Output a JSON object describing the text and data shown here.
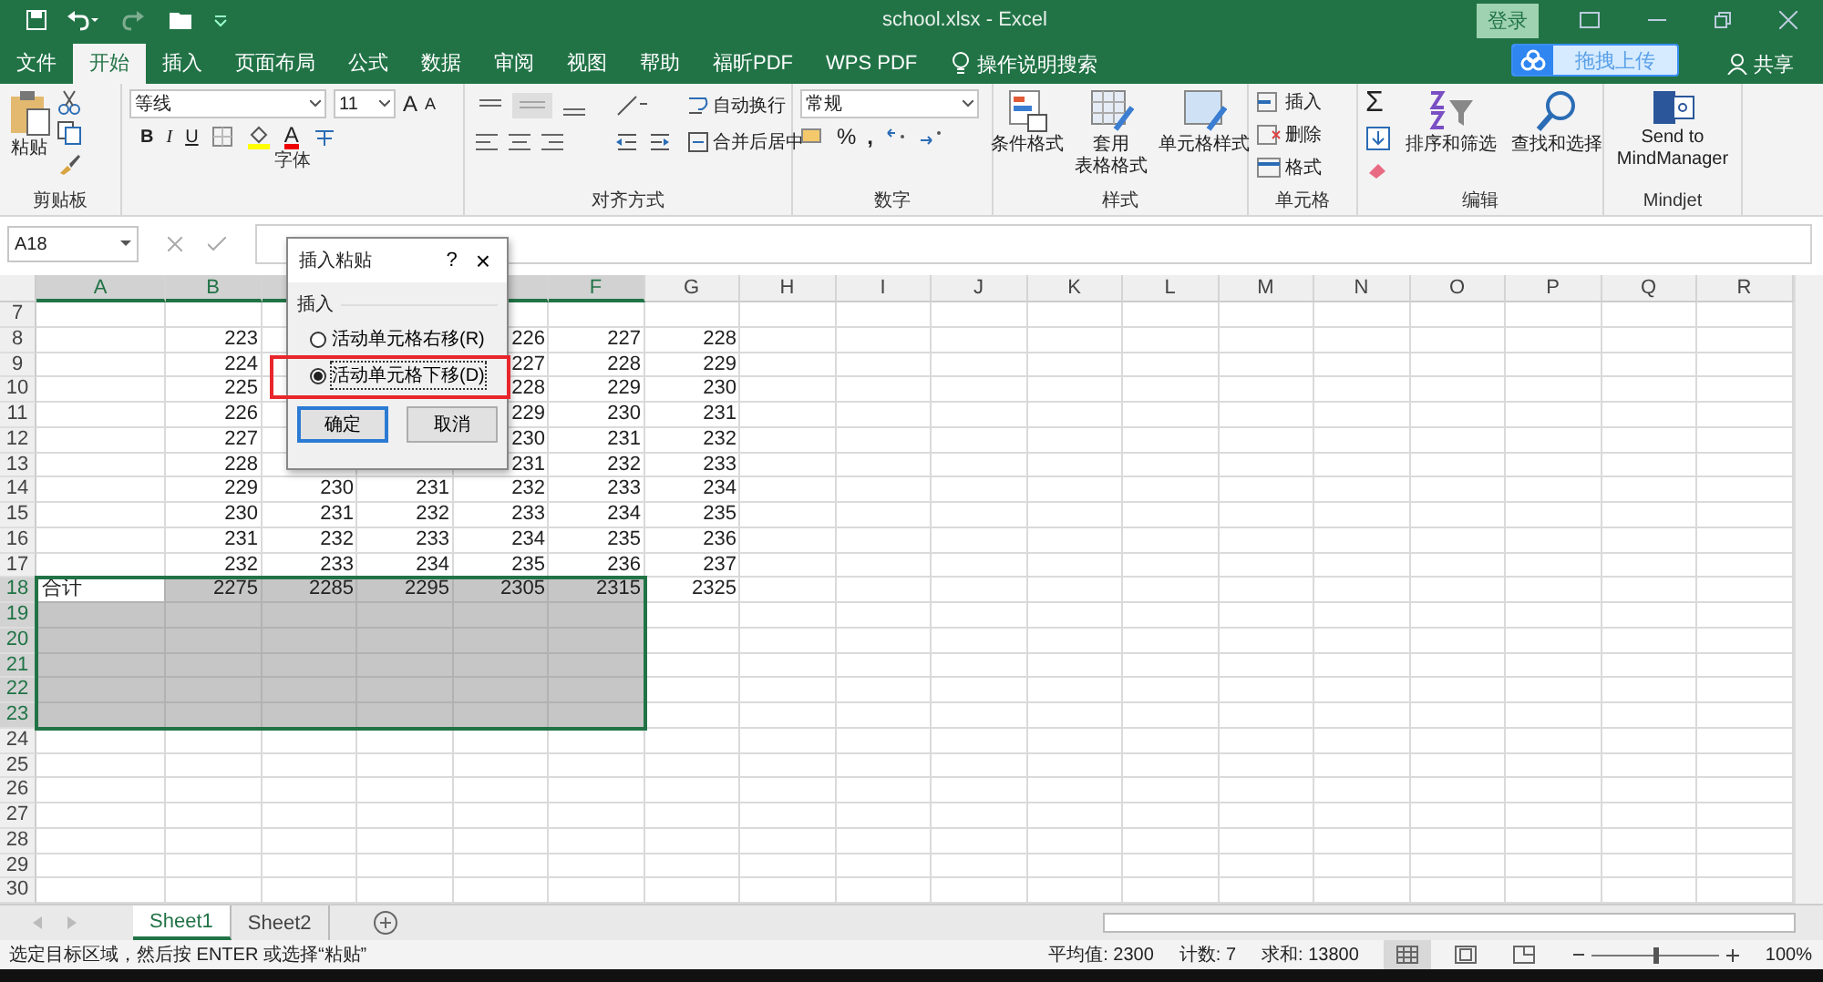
{
  "window": {
    "title": "school.xlsx  -  Excel",
    "login_button": "登录"
  },
  "menu_tabs": [
    {
      "label": "文件",
      "selected": false
    },
    {
      "label": "开始",
      "selected": true
    },
    {
      "label": "插入",
      "selected": false
    },
    {
      "label": "页面布局",
      "selected": false
    },
    {
      "label": "公式",
      "selected": false
    },
    {
      "label": "数据",
      "selected": false
    },
    {
      "label": "审阅",
      "selected": false
    },
    {
      "label": "视图",
      "selected": false
    },
    {
      "label": "帮助",
      "selected": false
    },
    {
      "label": "福昕PDF",
      "selected": false
    },
    {
      "label": "WPS PDF",
      "selected": false
    }
  ],
  "tell_me": "操作说明搜索",
  "upload_button": "拖拽上传",
  "share_button": "共享",
  "ribbon": {
    "clipboard": {
      "paste": "粘贴",
      "label": "剪贴板"
    },
    "font": {
      "name": "等线",
      "size": "11",
      "grow": "A",
      "shrink": "A",
      "bold": "B",
      "italic": "I",
      "underline": "U",
      "text_color_button": "A",
      "label": "字体"
    },
    "alignment": {
      "wrap": "自动换行",
      "merge": "合并后居中",
      "label": "对齐方式"
    },
    "number": {
      "format": "常规",
      "percent": "%",
      "comma": ",",
      "label": "数字"
    },
    "styles": {
      "conditional": "条件格式",
      "table": [
        "套用",
        "表格格式"
      ],
      "cell_styles": "单元格样式",
      "label": "样式"
    },
    "cells": {
      "insert": "插入",
      "delete": "删除",
      "format": "格式",
      "label": "单元格"
    },
    "editing": {
      "sum": "Σ",
      "sort": "排序和筛选",
      "find": "查找和选择",
      "label": "编辑"
    },
    "mindjet": {
      "send": [
        "Send to",
        "MindManager"
      ],
      "label": "Mindjet"
    }
  },
  "name_box": "A18",
  "columns": [
    {
      "letter": "A",
      "selected": true
    },
    {
      "letter": "B",
      "selected": true
    },
    {
      "selected": true
    },
    null,
    {
      "selected": true
    },
    {
      "letter": "F",
      "selected": true
    },
    {
      "letter": "G",
      "selected": false
    },
    {
      "letter": "H",
      "selected": false
    },
    {
      "letter": "I",
      "selected": false
    },
    {
      "letter": "J",
      "selected": false
    },
    {
      "letter": "K",
      "selected": false
    },
    {
      "letter": "L",
      "selected": false
    },
    {
      "letter": "M",
      "selected": false
    },
    {
      "letter": "N",
      "selected": false
    },
    {
      "letter": "O",
      "selected": false
    },
    {
      "letter": "P",
      "selected": false
    },
    {
      "letter": "Q",
      "selected": false
    },
    {
      "letter": "R",
      "selected": false
    }
  ],
  "rows": [
    {
      "num": "7",
      "selected": false,
      "cells": []
    },
    {
      "num": "8",
      "selected": false,
      "cells": [
        null,
        "223",
        null,
        null,
        "226",
        "227",
        "228"
      ]
    },
    {
      "num": "9",
      "selected": false,
      "cells": [
        null,
        "224",
        null,
        null,
        "227",
        "228",
        "229"
      ]
    },
    {
      "num": "10",
      "selected": false,
      "cells": [
        null,
        "225",
        null,
        null,
        "228",
        "229",
        "230"
      ]
    },
    {
      "num": "11",
      "selected": false,
      "cells": [
        null,
        "226",
        null,
        null,
        "229",
        "230",
        "231"
      ]
    },
    {
      "num": "12",
      "selected": false,
      "cells": [
        null,
        "227",
        null,
        null,
        "230",
        "231",
        "232"
      ]
    },
    {
      "num": "13",
      "selected": false,
      "cells": [
        null,
        "228",
        null,
        null,
        "231",
        "232",
        "233"
      ]
    },
    {
      "num": "14",
      "selected": false,
      "cells": [
        null,
        "229",
        "230",
        "231",
        "232",
        "233",
        "234"
      ]
    },
    {
      "num": "15",
      "selected": false,
      "cells": [
        null,
        "230",
        "231",
        "232",
        "233",
        "234",
        "235"
      ]
    },
    {
      "num": "16",
      "selected": false,
      "cells": [
        null,
        "231",
        "232",
        "233",
        "234",
        "235",
        "236"
      ]
    },
    {
      "num": "17",
      "selected": false,
      "cells": [
        null,
        "232",
        "233",
        "234",
        "235",
        "236",
        "237"
      ]
    },
    {
      "num": "18",
      "selected": true,
      "cells": [
        {
          "text": "合计",
          "active": true
        },
        "2275",
        "2285",
        "2295",
        "2305",
        "2315",
        "2325"
      ]
    },
    {
      "num": "19",
      "selected": true,
      "cells": []
    },
    {
      "num": "20",
      "selected": true,
      "cells": []
    },
    {
      "num": "21",
      "selected": true,
      "cells": []
    },
    {
      "num": "22",
      "selected": true,
      "cells": []
    },
    {
      "num": "23",
      "selected": true,
      "cells": []
    },
    {
      "num": "24",
      "selected": false,
      "cells": []
    },
    {
      "num": "25",
      "selected": false,
      "cells": []
    },
    {
      "num": "26",
      "selected": false,
      "cells": []
    },
    {
      "num": "27",
      "selected": false,
      "cells": []
    },
    {
      "num": "28",
      "selected": false,
      "cells": []
    },
    {
      "num": "29",
      "selected": false,
      "cells": []
    },
    {
      "num": "30",
      "selected": false,
      "cells": []
    }
  ],
  "dialog": {
    "title": "插入粘贴",
    "help": "?",
    "close": "×",
    "group": "插入",
    "options": [
      {
        "label": "活动单元格右移(R)",
        "selected": false
      },
      {
        "label": "活动单元格下移(D)",
        "selected": true
      }
    ],
    "ok": "确定",
    "cancel": "取消"
  },
  "sheets": [
    {
      "label": "Sheet1",
      "selected": true
    },
    {
      "label": "Sheet2",
      "selected": false
    }
  ],
  "status_bar": {
    "message": "选定目标区域，然后按 ENTER 或选择“粘贴”",
    "average": "平均值: 2300",
    "count": "计数: 7",
    "sum": "求和: 13800",
    "view_buttons": [
      {
        "kind": "normal",
        "selected": true
      },
      {
        "kind": "page_layout",
        "selected": false
      },
      {
        "kind": "page_break",
        "selected": false
      }
    ],
    "zoom": {
      "level": 0.5
    },
    "zoom_text": "100%"
  }
}
